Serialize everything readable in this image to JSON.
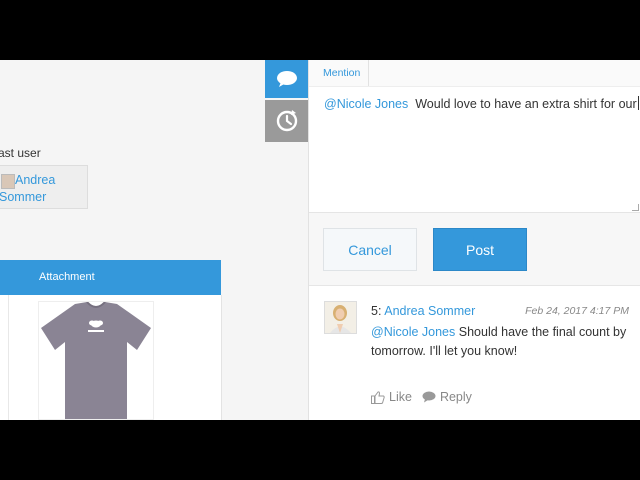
{
  "record": {
    "field_label": "ast user",
    "user_name": "Andrea Sommer",
    "table_header": "Attachment"
  },
  "editor": {
    "mention_label": "Mention",
    "mention_user": "@Nicole Jones",
    "draft_text": "Would love to have an extra shirt for our"
  },
  "buttons": {
    "cancel": "Cancel",
    "post": "Post"
  },
  "comment": {
    "number": "5:",
    "author": "Andrea Sommer",
    "date": "Feb 24, 2017 4:17 PM",
    "mention_user": "@Nicole Jones",
    "text": "Should have the final count by tomorrow. I'll let you know!",
    "like_label": "Like",
    "reply_label": "Reply"
  },
  "colors": {
    "accent": "#3498db",
    "history_tab": "#9a9a9a"
  },
  "icons": {
    "comments_tab": "speech-bubble-icon",
    "history_tab": "history-icon",
    "like": "thumbs-up-icon",
    "reply": "speech-bubble-icon"
  }
}
